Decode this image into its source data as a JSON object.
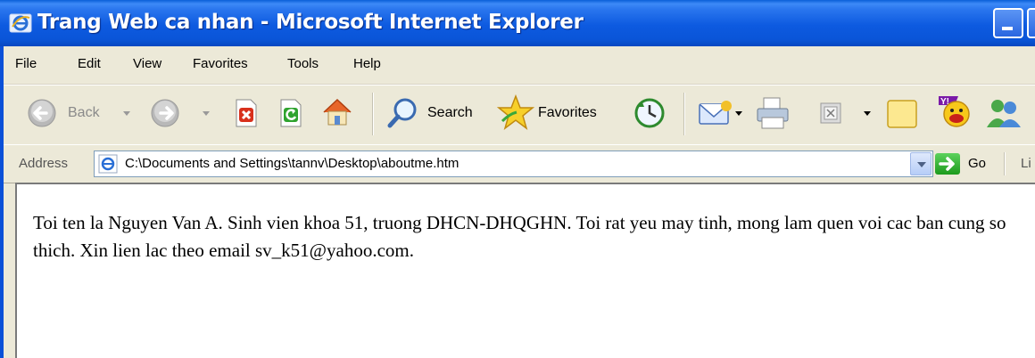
{
  "window": {
    "title": "Trang Web ca nhan - Microsoft Internet Explorer"
  },
  "menu": [
    "File",
    "Edit",
    "View",
    "Favorites",
    "Tools",
    "Help"
  ],
  "toolbar": {
    "back_label": "Back",
    "search_label": "Search",
    "favorites_label": "Favorites"
  },
  "address": {
    "label": "Address",
    "url": "C:\\Documents and Settings\\tannv\\Desktop\\aboutme.htm",
    "go_label": "Go",
    "links_label": "Li"
  },
  "page": {
    "text": "Toi ten la Nguyen Van A. Sinh vien khoa 51, truong DHCN-DHQGHN. Toi rat yeu may tinh, mong lam quen voi cac ban cung so thich. Xin lien lac theo email sv_k51@yahoo.com."
  },
  "colors": {
    "titlebar": "#0a55d8",
    "chrome": "#ece9d8"
  }
}
